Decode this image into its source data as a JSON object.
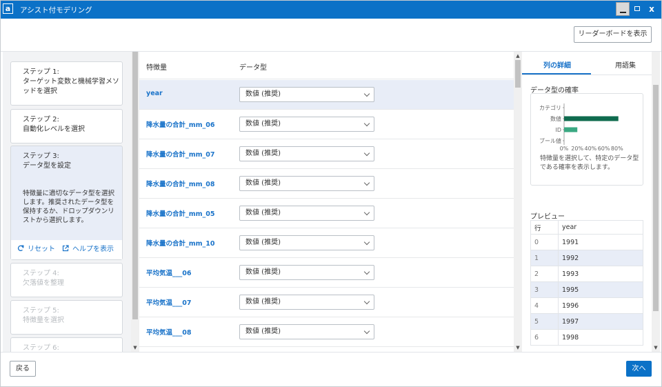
{
  "window": {
    "title": "アシスト付モデリング",
    "logo_char": "a",
    "minimize_icon": "minimize-icon",
    "maximize_icon": "maximize-icon",
    "close_label": "x"
  },
  "header": {
    "leaderboard_label": "リーダーボードを表示"
  },
  "steps": [
    {
      "label": "ステップ 1:\nターゲット変数と機械学習メソッドを選択",
      "state": "completed"
    },
    {
      "label": "ステップ 2:\n自動化レベルを選択",
      "state": "completed"
    },
    {
      "label": "ステップ 3:\nデータ型を設定",
      "state": "active",
      "description": "特徴量に適切なデータ型を選択します。推奨されたデータ型を保持するか、ドロップダウンリストから選択します。"
    },
    {
      "label": "ステップ 4:\n欠落値を整理",
      "state": "disabled"
    },
    {
      "label": "ステップ 5:\n特徴量を選択",
      "state": "disabled"
    },
    {
      "label": "ステップ 6:",
      "state": "disabled"
    }
  ],
  "step_actions": {
    "reset_label": "リセット",
    "help_label": "ヘルプを表示"
  },
  "features_table": {
    "col_feature": "特徴量",
    "col_type": "データ型",
    "rows": [
      {
        "name": "year",
        "type": "数値 (推奨)",
        "selected": true
      },
      {
        "name": "降水量の合計_mm_06",
        "type": "数値 (推奨)"
      },
      {
        "name": "降水量の合計_mm_07",
        "type": "数値 (推奨)"
      },
      {
        "name": "降水量の合計_mm_08",
        "type": "数値 (推奨)"
      },
      {
        "name": "降水量の合計_mm_05",
        "type": "数値 (推奨)"
      },
      {
        "name": "降水量の合計_mm_10",
        "type": "数値 (推奨)"
      },
      {
        "name": "平均気温___06",
        "type": "数値 (推奨)"
      },
      {
        "name": "平均気温___07",
        "type": "数値 (推奨)"
      },
      {
        "name": "平均気温___08",
        "type": "数値 (推奨)"
      }
    ]
  },
  "right_panel": {
    "tabs": [
      "列の詳細",
      "用語集"
    ],
    "active_tab": 0,
    "prob_title": "データ型の確率",
    "prob_note": "特徴量を選択して、特定のデータ型である確率を表示します。",
    "preview_title": "プレビュー",
    "preview_headers": [
      "行",
      "year"
    ],
    "preview_rows": [
      [
        "0",
        "1991"
      ],
      [
        "1",
        "1992"
      ],
      [
        "2",
        "1993"
      ],
      [
        "3",
        "1995"
      ],
      [
        "4",
        "1996"
      ],
      [
        "5",
        "1997"
      ],
      [
        "6",
        "1998"
      ]
    ]
  },
  "chart_data": {
    "type": "bar",
    "orientation": "horizontal",
    "categories": [
      "カテゴリ",
      "数値",
      "ID",
      "ブール値"
    ],
    "values": [
      0,
      82,
      20,
      0
    ],
    "x_ticks": [
      "0%",
      "20%",
      "40%",
      "60%",
      "80%"
    ],
    "xlim": [
      0,
      100
    ],
    "bar_colors": [
      "#0f6b4e",
      "#0f6b4e",
      "#3aa882",
      "#0f6b4e"
    ]
  },
  "footer": {
    "back_label": "戻る",
    "next_label": "次へ"
  },
  "colors": {
    "accent": "#0b71c7",
    "link": "#1a73c9",
    "selected_row": "#e8edf7"
  }
}
